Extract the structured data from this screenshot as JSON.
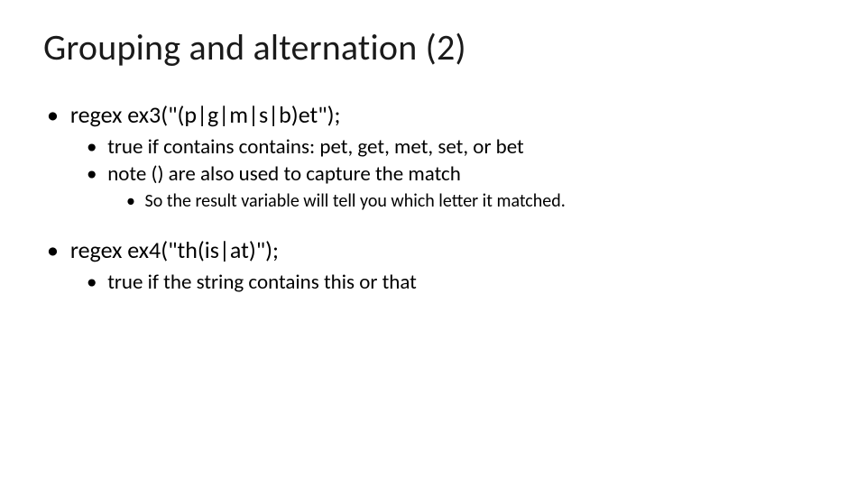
{
  "title": "Grouping and alternation (2)",
  "bullets": [
    {
      "text": "regex ex3(\"(p|g|m|s|b)et\");",
      "children": [
        {
          "text": "true if contains contains: pet, get, met, set, or bet"
        },
        {
          "text": "note () are also used to capture the match",
          "children": [
            {
              "text": "So the result variable will tell you which letter it matched."
            }
          ]
        }
      ]
    },
    {
      "text": "regex ex4(\"th(is|at)\");",
      "children": [
        {
          "text": "true if the string contains this or that"
        }
      ]
    }
  ]
}
